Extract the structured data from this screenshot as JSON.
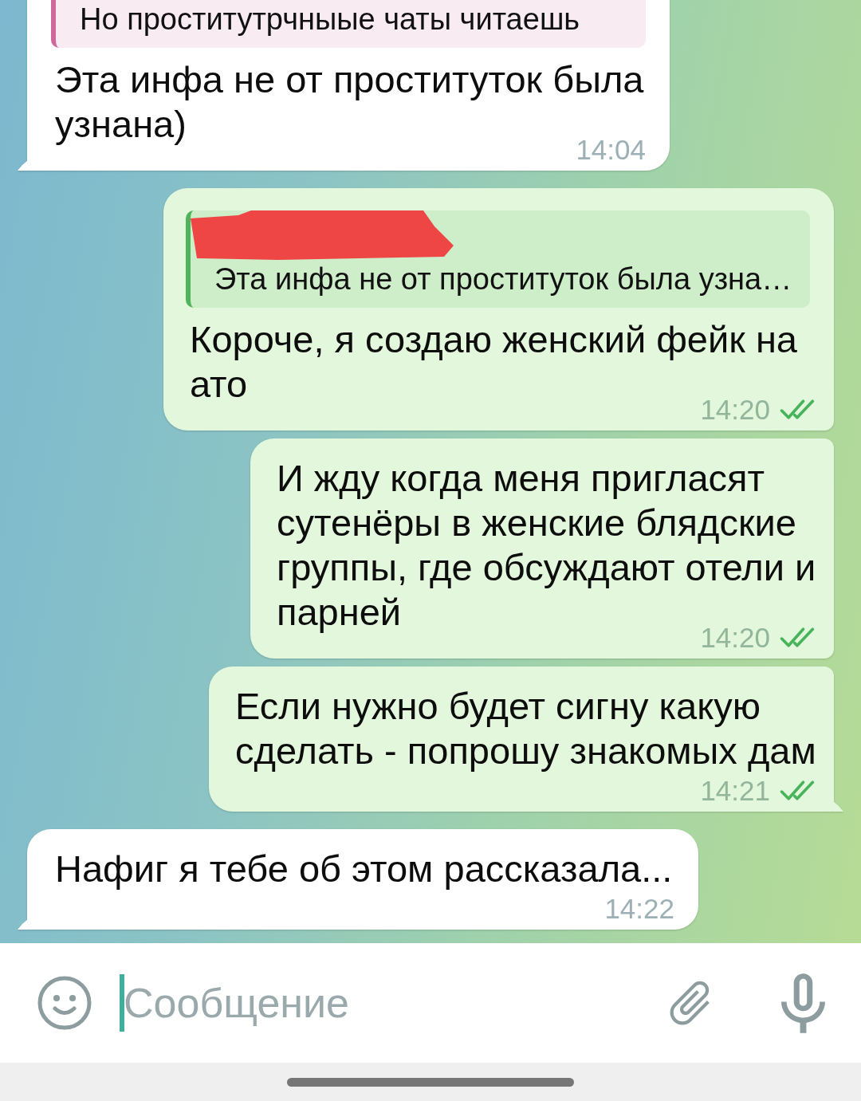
{
  "chat": {
    "messages": [
      {
        "kind": "incoming",
        "reply": {
          "text": "Но проститутрчныые чаты читаешь",
          "color": "#d0689c"
        },
        "text": "Эта инфа не от проституток была узнана)",
        "time": "14:04"
      },
      {
        "kind": "outgoing",
        "reply": {
          "text": "Эта инфа не от проституток была узна…",
          "color": "#4fb35b",
          "redacted": true
        },
        "text": "Короче, я создаю женский фейк на ато",
        "time": "14:20",
        "read": true
      },
      {
        "kind": "outgoing",
        "text": "И жду когда меня пригласят сутенёры в женские блядские группы, где обсуждают отели и парней",
        "time": "14:20",
        "read": true
      },
      {
        "kind": "outgoing",
        "text": "Если нужно будет сигну какую сделать - попрошу знакомых дам",
        "time": "14:21",
        "read": true
      },
      {
        "kind": "incoming",
        "text": "Нафиг я тебе об этом рассказала...",
        "time": "14:22"
      }
    ]
  },
  "composer": {
    "placeholder": "Сообщение",
    "focused": true
  }
}
